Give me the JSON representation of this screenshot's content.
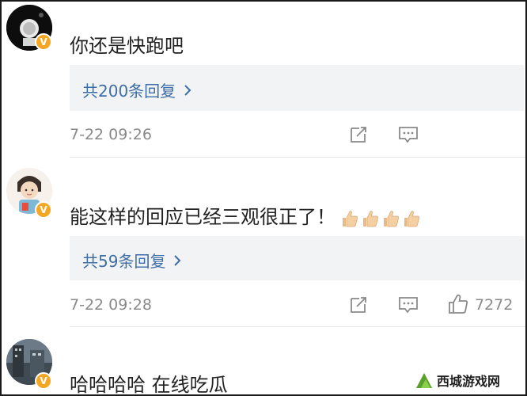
{
  "comments": [
    {
      "text": "你还是快跑吧",
      "reply_label": "共200条回复",
      "timestamp": "7-22 09:26",
      "verified": "V"
    },
    {
      "text": "能这样的回应已经三观很正了！",
      "emoji": [
        "thumbs-up-icon",
        "thumbs-up-icon",
        "thumbs-up-icon",
        "thumbs-up-icon"
      ],
      "reply_label": "共59条回复",
      "timestamp": "7-22 09:28",
      "like_count": "7272",
      "verified": "V"
    },
    {
      "text": "哈哈哈哈 在线吃瓜",
      "verified": "V"
    }
  ],
  "watermark": {
    "text": "西城游戏网"
  },
  "colors": {
    "reply_link": "#3e6ea5",
    "reply_bg": "#f2f3f5",
    "badge": "#f5a623",
    "meta_text": "#8a8a8a"
  }
}
